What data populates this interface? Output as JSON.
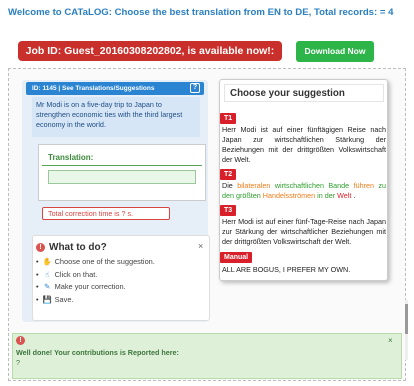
{
  "welcome": "Welcome to CATaLOG: Choose the best translation from EN to DE, Total records: = 4",
  "job_banner": "Job ID: Guest_20160308202802, is available now!:",
  "download_label": "Download Now",
  "panel": {
    "header": "ID: 1145 | See Translations/Suggestions",
    "source": "Mr Modi is on a five-day trip to Japan to strengthen economic ties with the third largest economy in the world.",
    "translation_label": "Translation:",
    "translation_value": "",
    "correction_time": "Total correction time is ? s."
  },
  "todo": {
    "title": "What to do?",
    "close": "×",
    "items": [
      {
        "icon": "person-icon",
        "glyph": "✋",
        "label": "Choose one of the suggestion."
      },
      {
        "icon": "pointer-icon",
        "glyph": "☝",
        "label": "Click on that."
      },
      {
        "icon": "edit-icon",
        "glyph": "✎",
        "label": "Make your correction."
      },
      {
        "icon": "save-icon",
        "glyph": "💾",
        "label": "Save."
      }
    ]
  },
  "suggestions": {
    "title": "Choose your suggestion",
    "items": [
      {
        "tag": "T1",
        "text": "Herr Modi ist auf einer fünftägigen Reise nach Japan zur wirtschaftlichen Stärkung der Beziehungen mit der drittgrößten Volkswirtschaft der Welt."
      },
      {
        "tag": "T2",
        "parts": [
          {
            "t": "Die ",
            "c": ""
          },
          {
            "t": "bilateralen",
            "c": "orange"
          },
          {
            "t": " ",
            "c": ""
          },
          {
            "t": "wirtschaftlichen",
            "c": "green"
          },
          {
            "t": " ",
            "c": ""
          },
          {
            "t": "Bande",
            "c": "green"
          },
          {
            "t": " ",
            "c": ""
          },
          {
            "t": "führen",
            "c": "orange"
          },
          {
            "t": " zu den ",
            "c": "green"
          },
          {
            "t": "größten",
            "c": "green"
          },
          {
            "t": " ",
            "c": ""
          },
          {
            "t": "Handelsströmen",
            "c": "orange"
          },
          {
            "t": " in der ",
            "c": "green"
          },
          {
            "t": "Welt",
            "c": "red"
          },
          {
            "t": " .",
            "c": ""
          }
        ]
      },
      {
        "tag": "T3",
        "text": "Herr Modi ist auf einer fünf-Tage-Reise nach Japan zur Stärkung der wirtschaftlicher Beziehungen mit der drittgrößten Volkswirtschaft der Welt."
      },
      {
        "tag": "Manual",
        "text": "ALL ARE BOGUS, I PREFER MY OWN."
      }
    ]
  },
  "success": {
    "text": "Well done! Your contributions is Reported here:",
    "value": "?",
    "close": "×"
  },
  "colors": {
    "accent_blue": "#2a84d2",
    "banner_red": "#c9302c",
    "download_green": "#2eb54a",
    "tag_red": "#d9202a",
    "success_bg": "#dff0d8"
  }
}
